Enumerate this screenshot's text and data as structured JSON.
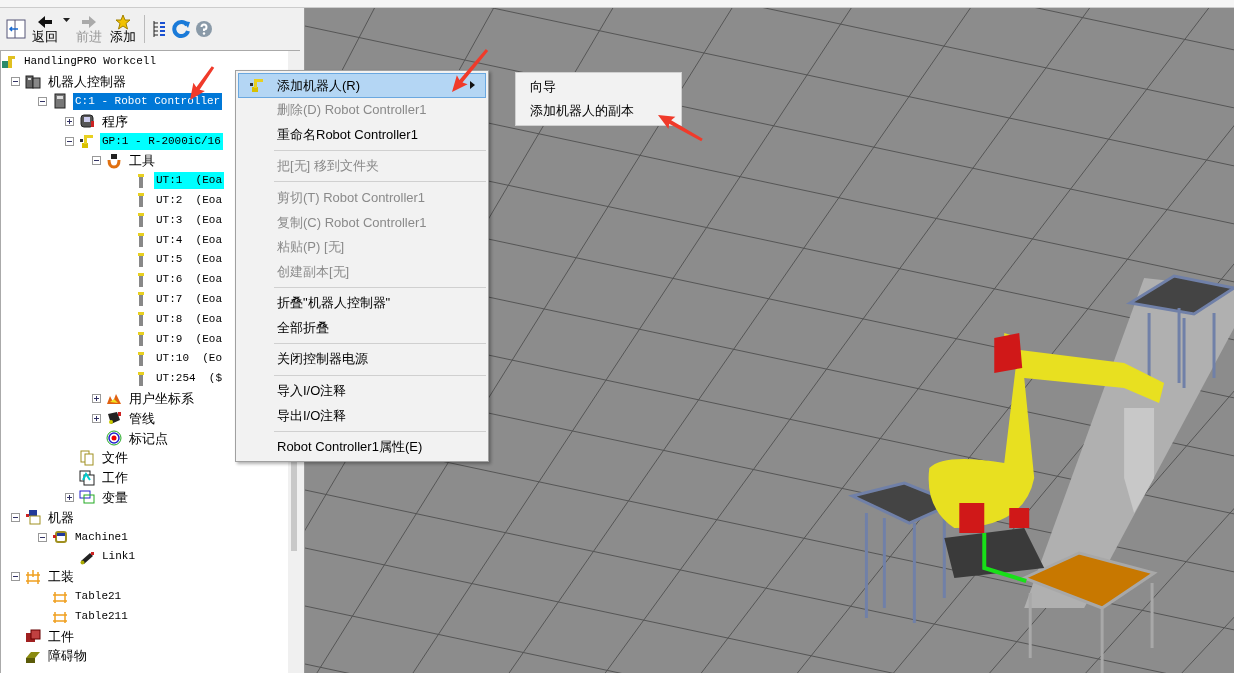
{
  "toolbar": {
    "buttons": [
      {
        "label": "返回",
        "disabled": false,
        "dropdown": true
      },
      {
        "label": "前进",
        "disabled": true,
        "dropdown": false
      },
      {
        "label": "添加",
        "disabled": false,
        "dropdown": false
      }
    ]
  },
  "tree": {
    "root": {
      "label": "HandlingPRO Workcell",
      "kind": "workcell",
      "selected": false,
      "highlighted": false,
      "children": [
        {
          "label": "机器人控制器",
          "kind": "controllers",
          "selected": false,
          "highlighted": false,
          "expanded": true,
          "children": [
            {
              "label": "C:1 - Robot Controller",
              "kind": "controller",
              "selected": true,
              "highlighted": false,
              "expanded": true,
              "children": [
                {
                  "label": "程序",
                  "kind": "program",
                  "selected": false,
                  "highlighted": false,
                  "expanded": false
                },
                {
                  "label": "GP:1 - R-2000iC/16",
                  "kind": "robot",
                  "selected": false,
                  "highlighted": true,
                  "expanded": true,
                  "children": [
                    {
                      "label": "工具",
                      "kind": "tools",
                      "selected": false,
                      "highlighted": false,
                      "expanded": true,
                      "children": [
                        {
                          "label": "UT:1  (Eoa",
                          "kind": "tool",
                          "selected": false,
                          "highlighted": true
                        },
                        {
                          "label": "UT:2  (Eoa",
                          "kind": "tool",
                          "selected": false,
                          "highlighted": false
                        },
                        {
                          "label": "UT:3  (Eoa",
                          "kind": "tool",
                          "selected": false,
                          "highlighted": false
                        },
                        {
                          "label": "UT:4  (Eoa",
                          "kind": "tool",
                          "selected": false,
                          "highlighted": false
                        },
                        {
                          "label": "UT:5  (Eoa",
                          "kind": "tool",
                          "selected": false,
                          "highlighted": false
                        },
                        {
                          "label": "UT:6  (Eoa",
                          "kind": "tool",
                          "selected": false,
                          "highlighted": false
                        },
                        {
                          "label": "UT:7  (Eoa",
                          "kind": "tool",
                          "selected": false,
                          "highlighted": false
                        },
                        {
                          "label": "UT:8  (Eoa",
                          "kind": "tool",
                          "selected": false,
                          "highlighted": false
                        },
                        {
                          "label": "UT:9  (Eoa",
                          "kind": "tool",
                          "selected": false,
                          "highlighted": false
                        },
                        {
                          "label": "UT:10  (Eo",
                          "kind": "tool",
                          "selected": false,
                          "highlighted": false
                        },
                        {
                          "label": "UT:254  ($",
                          "kind": "tool",
                          "selected": false,
                          "highlighted": false
                        }
                      ]
                    },
                    {
                      "label": "用户坐标系",
                      "kind": "frames",
                      "selected": false,
                      "highlighted": false,
                      "expanded": false
                    },
                    {
                      "label": "管线",
                      "kind": "cable",
                      "selected": false,
                      "highlighted": false,
                      "expanded": false
                    },
                    {
                      "label": "标记点",
                      "kind": "marker",
                      "selected": false,
                      "highlighted": false
                    }
                  ]
                },
                {
                  "label": "文件",
                  "kind": "file",
                  "selected": false,
                  "highlighted": false
                },
                {
                  "label": "工作",
                  "kind": "job",
                  "selected": false,
                  "highlighted": false
                },
                {
                  "label": "变量",
                  "kind": "variable",
                  "selected": false,
                  "highlighted": false,
                  "expanded": false
                }
              ]
            }
          ]
        },
        {
          "label": "机器",
          "kind": "machines",
          "selected": false,
          "highlighted": false,
          "expanded": true,
          "children": [
            {
              "label": "Machine1",
              "kind": "machine",
              "selected": false,
              "highlighted": false,
              "expanded": true,
              "children": [
                {
                  "label": "Link1",
                  "kind": "link",
                  "selected": false,
                  "highlighted": false
                }
              ]
            }
          ]
        },
        {
          "label": "工装",
          "kind": "fixtures",
          "selected": false,
          "highlighted": false,
          "expanded": true,
          "children": [
            {
              "label": "Table21",
              "kind": "fixture",
              "selected": false,
              "highlighted": false
            },
            {
              "label": "Table211",
              "kind": "fixture",
              "selected": false,
              "highlighted": false
            }
          ]
        },
        {
          "label": "工件",
          "kind": "part",
          "selected": false,
          "highlighted": false
        },
        {
          "label": "障碍物",
          "kind": "obstacle",
          "selected": false,
          "highlighted": false
        }
      ]
    }
  },
  "context_menu": {
    "items": [
      {
        "kind": "item",
        "label": "添加机器人(R)",
        "disabled": false,
        "selected": true,
        "submenu": true
      },
      {
        "kind": "item",
        "label": "删除(D) Robot Controller1",
        "disabled": true,
        "selected": false,
        "submenu": false
      },
      {
        "kind": "item",
        "label": "重命名Robot Controller1",
        "disabled": false,
        "selected": false,
        "submenu": false
      },
      {
        "kind": "separator"
      },
      {
        "kind": "item",
        "label": "把[无] 移到文件夹",
        "disabled": true,
        "selected": false,
        "submenu": false
      },
      {
        "kind": "separator"
      },
      {
        "kind": "item",
        "label": "剪切(T) Robot Controller1",
        "disabled": true,
        "selected": false,
        "submenu": false
      },
      {
        "kind": "item",
        "label": "复制(C) Robot Controller1",
        "disabled": true,
        "selected": false,
        "submenu": false
      },
      {
        "kind": "item",
        "label": "粘贴(P) [无]",
        "disabled": true,
        "selected": false,
        "submenu": false
      },
      {
        "kind": "item",
        "label": "创建副本[无]",
        "disabled": true,
        "selected": false,
        "submenu": false
      },
      {
        "kind": "separator"
      },
      {
        "kind": "item",
        "label": "折叠\"机器人控制器\"",
        "disabled": false,
        "selected": false,
        "submenu": false
      },
      {
        "kind": "item",
        "label": "全部折叠",
        "disabled": false,
        "selected": false,
        "submenu": false
      },
      {
        "kind": "separator"
      },
      {
        "kind": "item",
        "label": "关闭控制器电源",
        "disabled": false,
        "selected": false,
        "submenu": false
      },
      {
        "kind": "separator"
      },
      {
        "kind": "item",
        "label": "导入I/O注释",
        "disabled": false,
        "selected": false,
        "submenu": false
      },
      {
        "kind": "item",
        "label": "导出I/O注释",
        "disabled": false,
        "selected": false,
        "submenu": false
      },
      {
        "kind": "separator"
      },
      {
        "kind": "item",
        "label": "Robot Controller1属性(E)",
        "disabled": false,
        "selected": false,
        "submenu": false
      }
    ]
  },
  "submenu": {
    "items": [
      {
        "label": "向导"
      },
      {
        "label": "添加机器人的副本"
      }
    ]
  }
}
